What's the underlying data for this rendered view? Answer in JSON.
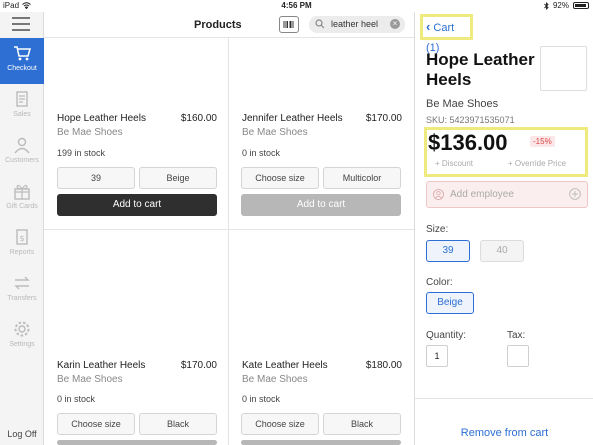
{
  "status_bar": {
    "device": "iPad",
    "time": "4:56 PM",
    "battery": "92%"
  },
  "sidebar": {
    "items": [
      {
        "label": "Checkout",
        "icon": "cart-icon",
        "active": true
      },
      {
        "label": "Sales",
        "icon": "document-icon",
        "active": false
      },
      {
        "label": "Customers",
        "icon": "person-icon",
        "active": false
      },
      {
        "label": "Gift Cards",
        "icon": "gift-icon",
        "active": false
      },
      {
        "label": "Reports",
        "icon": "report-icon",
        "active": false
      },
      {
        "label": "Transfers",
        "icon": "transfer-icon",
        "active": false
      },
      {
        "label": "Settings",
        "icon": "gear-icon",
        "active": false
      }
    ],
    "logoff": "Log Off"
  },
  "products": {
    "title": "Products",
    "search": {
      "value": "leather heel"
    },
    "cards": [
      {
        "name": "Hope Leather Heels",
        "price": "$160.00",
        "brand": "Be Mae Shoes",
        "stock": "199 in stock",
        "option1": "39",
        "option2": "Beige",
        "button": "Add to cart",
        "enabled": true
      },
      {
        "name": "Jennifer Leather Heels",
        "price": "$170.00",
        "brand": "Be Mae Shoes",
        "stock": "0 in stock",
        "option1": "Choose size",
        "option2": "Multicolor",
        "button": "Add to cart",
        "enabled": false
      },
      {
        "name": "Karin Leather Heels",
        "price": "$170.00",
        "brand": "Be Mae Shoes",
        "stock": "0 in stock",
        "option1": "Choose size",
        "option2": "Black"
      },
      {
        "name": "Kate Leather Heels",
        "price": "$180.00",
        "brand": "Be Mae Shoes",
        "stock": "0 in stock",
        "option1": "Choose size",
        "option2": "Black"
      }
    ]
  },
  "detail": {
    "back_label": "Cart (1)",
    "title": "Hope Leather Heels",
    "brand": "Be Mae Shoes",
    "sku": "SKU: 5423971535071",
    "price": "$136.00",
    "discount_badge": "-15%",
    "add_discount": "+ Discount",
    "override_price": "+ Override Price",
    "employee_placeholder": "Add employee",
    "size_label": "Size:",
    "sizes": [
      {
        "label": "39",
        "selected": true
      },
      {
        "label": "40",
        "selected": false
      }
    ],
    "color_label": "Color:",
    "colors": [
      {
        "label": "Beige",
        "selected": true
      }
    ],
    "quantity_label": "Quantity:",
    "quantity_value": "1",
    "tax_label": "Tax:",
    "remove_label": "Remove from cart"
  },
  "colors": {
    "accent": "#2d6fd3",
    "highlight": "#eeea7d",
    "dark_button": "#2f2f2f",
    "disabled_button": "#b7b7b7"
  }
}
